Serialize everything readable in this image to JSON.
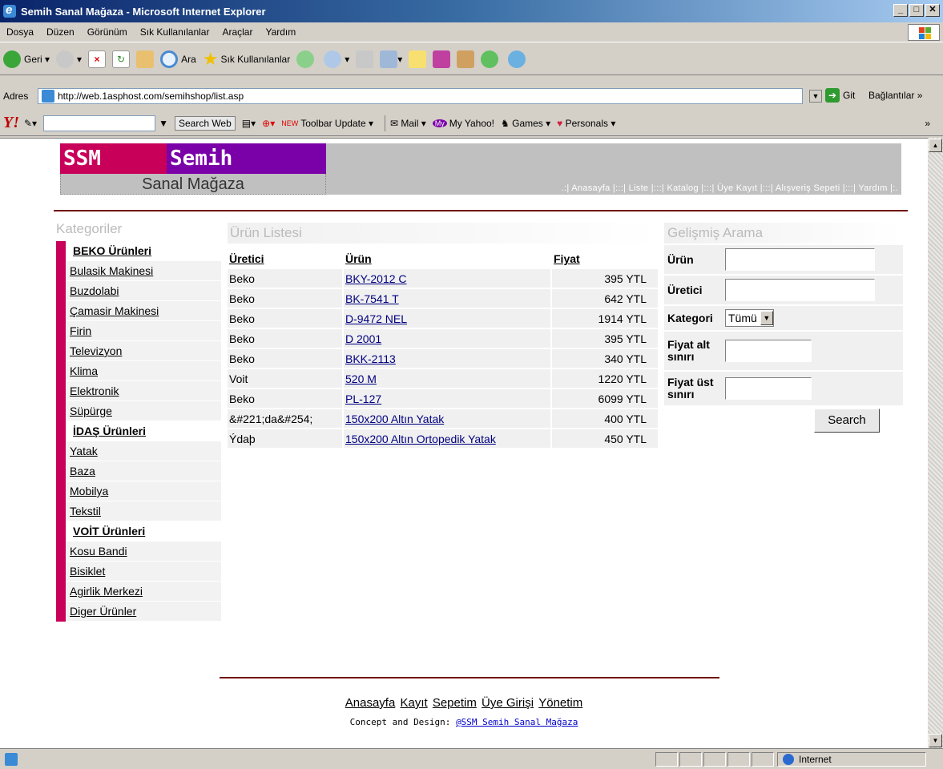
{
  "window": {
    "title": "Semih Sanal Mağaza - Microsoft Internet Explorer"
  },
  "menu": [
    "Dosya",
    "Düzen",
    "Görünüm",
    "Sık Kullanılanlar",
    "Araçlar",
    "Yardım"
  ],
  "toolbar": {
    "back": "Geri",
    "search": "Ara",
    "favorites": "Sık Kullanılanlar"
  },
  "address": {
    "label": "Adres",
    "url": "http://web.1asphost.com/semihshop/list.asp",
    "go": "Git",
    "links": "Bağlantılar"
  },
  "yahoo": {
    "logo": "Y!",
    "search_btn": "Search Web",
    "toolbar_update": "Toolbar Update",
    "mail": "Mail",
    "my_yahoo": "My Yahoo!",
    "games": "Games",
    "personals": "Personals"
  },
  "site": {
    "logo_ssm": "SSM",
    "logo_semih": "Semih",
    "logo_sub": "Sanal Mağaza",
    "nav": [
      ".:| Anasayfa |:::| Liste |:::| Katalog |:::| Üye Kayıt |:::| Alışveriş Sepeti |:::| Yardım |:."
    ]
  },
  "categories": {
    "title": "Kategoriler",
    "groups": [
      {
        "header": "BEKO Ürünleri",
        "items": [
          "Bulasik Makinesi",
          "Buzdolabi",
          "Çamasir Makinesi",
          "Firin",
          "Televizyon",
          "Klima",
          "Elektronik",
          "Süpürge"
        ]
      },
      {
        "header": "İDAŞ Ürünleri",
        "items": [
          "Yatak",
          "Baza",
          "Mobilya",
          "Tekstil"
        ]
      },
      {
        "header": "VOİT Ürünleri",
        "items": [
          "Kosu Bandi",
          "Bisiklet",
          "Agirlik Merkezi",
          "Diger Ürünler"
        ]
      }
    ]
  },
  "products": {
    "title": "Ürün Listesi",
    "columns": [
      "Üretici",
      "Ürün",
      "Fiyat"
    ],
    "rows": [
      [
        "Beko",
        "BKY-2012 C",
        "395 YTL"
      ],
      [
        "Beko",
        "BK-7541 T",
        "642 YTL"
      ],
      [
        "Beko",
        "D-9472 NEL",
        "1914 YTL"
      ],
      [
        "Beko",
        "D 2001",
        "395 YTL"
      ],
      [
        "Beko",
        "BKK-2113",
        "340 YTL"
      ],
      [
        "Voit",
        "520 M",
        "1220 YTL"
      ],
      [
        "Beko",
        "PL-127",
        "6099 YTL"
      ],
      [
        "&#221;da&#254;",
        "150x200 Altın Yatak",
        "400 YTL"
      ],
      [
        "Ýdaþ",
        "150x200 Altın Ortopedik Yatak",
        "450 YTL"
      ]
    ]
  },
  "search": {
    "title": "Gelişmiş Arama",
    "product_label": "Ürün",
    "maker_label": "Üretici",
    "category_label": "Kategori",
    "category_value": "Tümü",
    "min_price_label": "Fiyat alt sınırı",
    "max_price_label": "Fiyat üst sınırı",
    "button": "Search"
  },
  "footer": {
    "links": [
      "Anasayfa",
      "Kayıt",
      "Sepetim",
      "Üye Girişi",
      "Yönetim"
    ],
    "credit_prefix": "Concept and Design:",
    "credit_link": "@SSM Semih Sanal Mağaza"
  },
  "status": {
    "zone": "Internet"
  }
}
